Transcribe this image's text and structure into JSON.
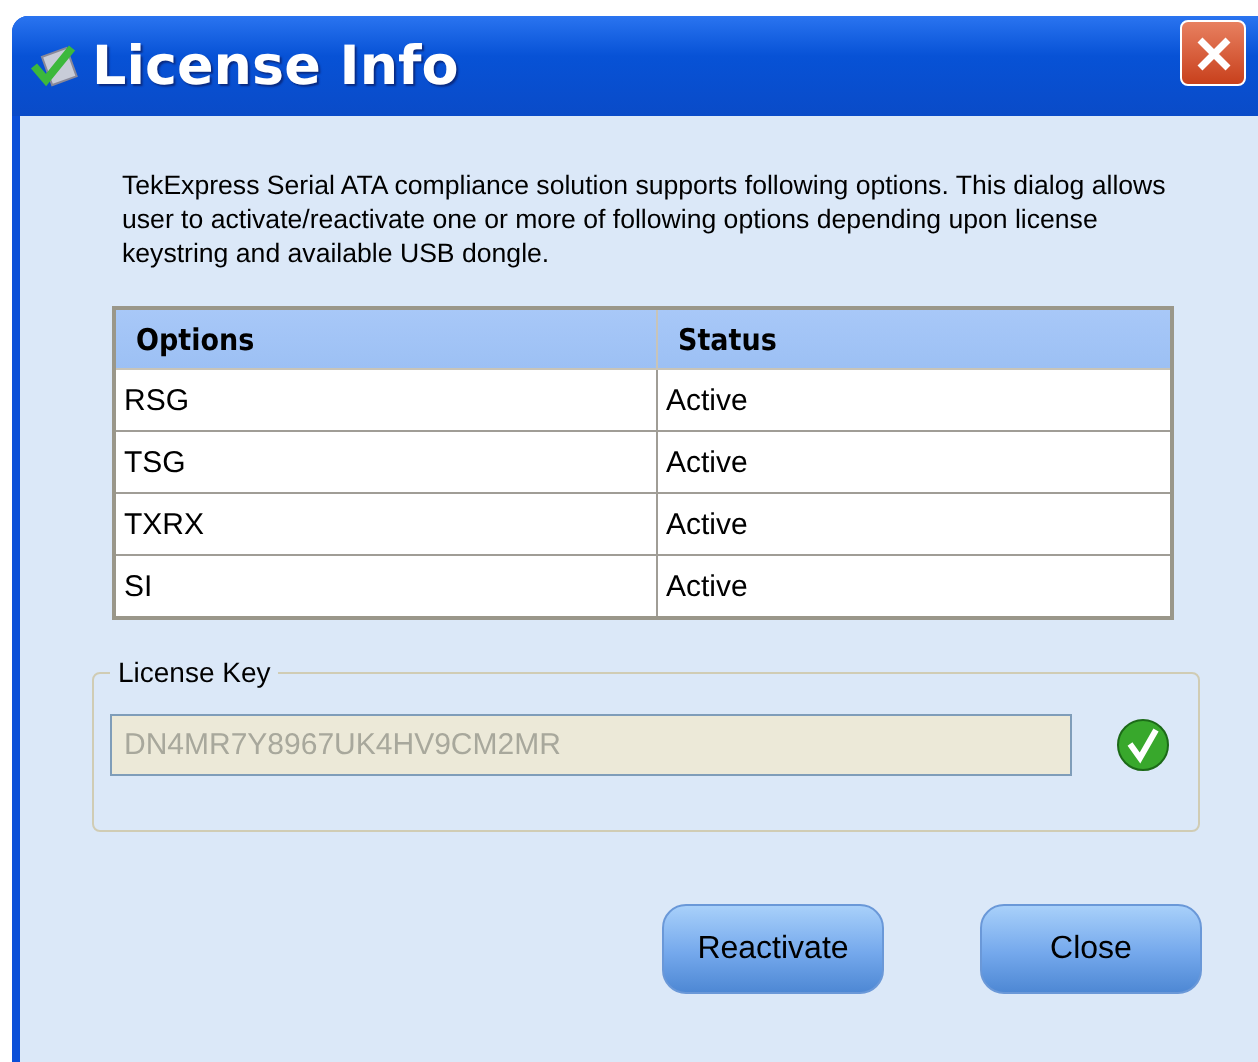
{
  "window": {
    "title": "License Info"
  },
  "description": "TekExpress Serial ATA compliance solution supports following options. This dialog allows user to activate/reactivate one or more of following options depending upon license keystring and available USB dongle.",
  "table": {
    "columns": [
      "Options",
      "Status"
    ],
    "rows": [
      [
        "RSG",
        "Active"
      ],
      [
        "TSG",
        "Active"
      ],
      [
        "TXRX",
        "Active"
      ],
      [
        "SI",
        "Active"
      ]
    ]
  },
  "license_key": {
    "label": "License Key",
    "value": "DN4MR7Y8967UK4HV9CM2MR",
    "disabled": true
  },
  "buttons": [
    "Reactivate",
    "Close"
  ]
}
